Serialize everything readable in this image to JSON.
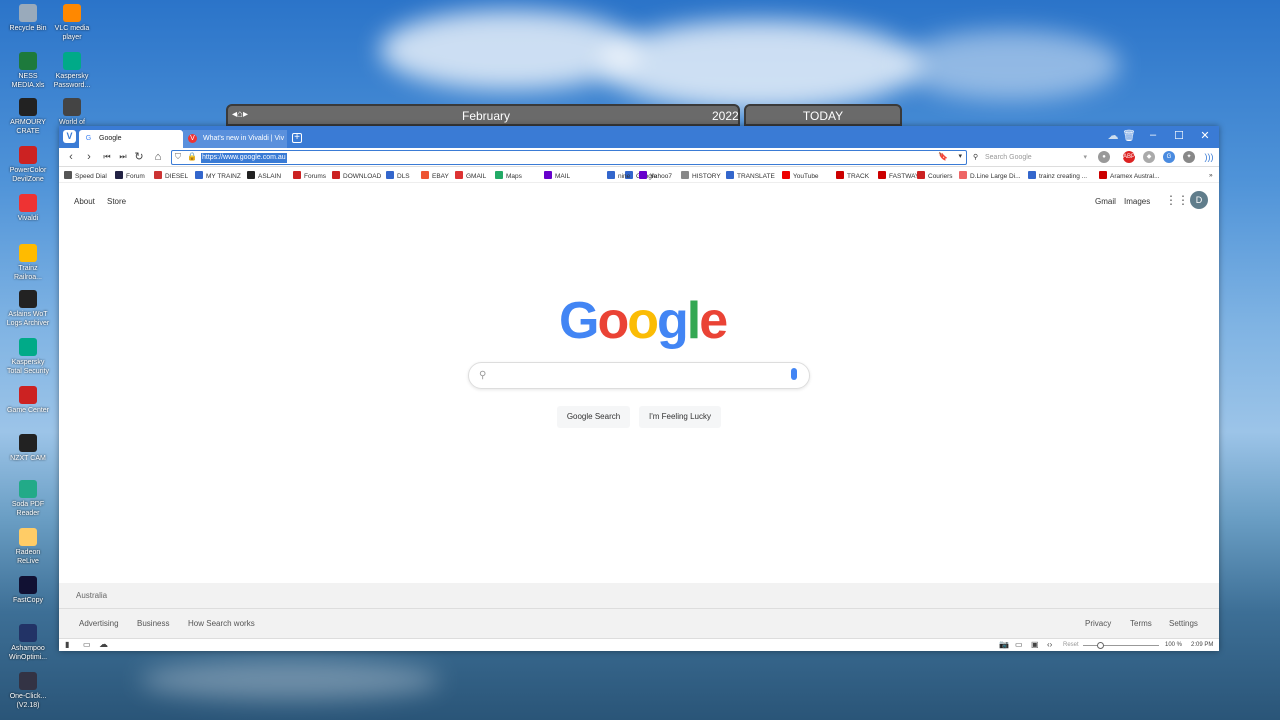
{
  "desktop": {
    "icons": [
      {
        "label": "Recycle Bin",
        "color": "#9ab"
      },
      {
        "label": "VLC media player",
        "color": "#f80"
      },
      {
        "label": "NESS MEDIA.xls",
        "color": "#1d7a3c"
      },
      {
        "label": "Kaspersky Password...",
        "color": "#0a8"
      },
      {
        "label": "ARMOURY CRATE",
        "color": "#222"
      },
      {
        "label": "World of Tan...",
        "color": "#444"
      },
      {
        "label": "PowerColor DevilZone",
        "color": "#c22"
      },
      {
        "label": "Vivaldi",
        "color": "#e33"
      },
      {
        "label": "Trainz Railroa...",
        "color": "#fb0"
      },
      {
        "label": "Aslains WoT Logs Archiver",
        "color": "#222"
      },
      {
        "label": "Kaspersky Total Security",
        "color": "#0a8"
      },
      {
        "label": "Game Center",
        "color": "#c22"
      },
      {
        "label": "NZXT CAM",
        "color": "#222"
      },
      {
        "label": "Soda PDF Reader",
        "color": "#2a8"
      },
      {
        "label": "Radeon ReLive",
        "color": "#fc6"
      },
      {
        "label": "FastCopy",
        "color": "#113"
      },
      {
        "label": "Ashampoo WinOptimi...",
        "color": "#236"
      },
      {
        "label": "One-Click... (V2.18)",
        "color": "#334"
      }
    ]
  },
  "calendar": {
    "month": "February",
    "year": "2022",
    "today": "TODAY"
  },
  "browser": {
    "tabs": [
      {
        "title": "Google",
        "favicon": "G",
        "active": true
      },
      {
        "title": "What's new in Vivaldi | Viv",
        "favicon": "V",
        "active": false
      }
    ],
    "url": "https://www.google.com.au",
    "search_placeholder": "Search Google",
    "bookmarks": [
      {
        "label": "Speed Dial",
        "color": "#555"
      },
      {
        "label": "Forum",
        "color": "#224"
      },
      {
        "label": "DIESEL",
        "color": "#c33"
      },
      {
        "label": "MY TRAINZ",
        "color": "#36c"
      },
      {
        "label": "ASLAIN",
        "color": "#222"
      },
      {
        "label": "Forums",
        "color": "#c22"
      },
      {
        "label": "DOWNLOAD",
        "color": "#c22"
      },
      {
        "label": "DLS",
        "color": "#36c"
      },
      {
        "label": "EBAY",
        "color": "#e53"
      },
      {
        "label": "GMAIL",
        "color": "#d33"
      },
      {
        "label": "Maps",
        "color": "#2a6"
      },
      {
        "label": "MAIL",
        "color": "#60c"
      },
      {
        "label": "Google",
        "color": "#36c"
      },
      {
        "label": "nine",
        "color": "#36c"
      },
      {
        "label": "Yahoo7",
        "color": "#60c"
      },
      {
        "label": "HISTORY",
        "color": "#888"
      },
      {
        "label": "TRANSLATE",
        "color": "#36c"
      },
      {
        "label": "YouTube",
        "color": "#e00"
      },
      {
        "label": "TRACK",
        "color": "#c00"
      },
      {
        "label": "FASTWAY",
        "color": "#c00"
      },
      {
        "label": "Couriers",
        "color": "#c22"
      },
      {
        "label": "D.Line Large Di...",
        "color": "#e66"
      },
      {
        "label": "trainz creating ...",
        "color": "#36c"
      },
      {
        "label": "Aramex Austral...",
        "color": "#c00"
      }
    ]
  },
  "google": {
    "nav_left": [
      "About",
      "Store"
    ],
    "nav_right": [
      "Gmail",
      "Images"
    ],
    "avatar": "D",
    "logo_letters": [
      {
        "ch": "G",
        "color": "#4285f4"
      },
      {
        "ch": "o",
        "color": "#ea4335"
      },
      {
        "ch": "o",
        "color": "#fbbc05"
      },
      {
        "ch": "g",
        "color": "#4285f4"
      },
      {
        "ch": "l",
        "color": "#34a853"
      },
      {
        "ch": "e",
        "color": "#ea4335"
      }
    ],
    "search_button": "Google Search",
    "lucky_button": "I'm Feeling Lucky",
    "footer_location": "Australia",
    "footer_left": [
      "Advertising",
      "Business",
      "How Search works"
    ],
    "footer_right": [
      "Privacy",
      "Terms",
      "Settings"
    ]
  },
  "statusbar": {
    "reset": "Reset",
    "zoom": "100 %",
    "time": "2:09 PM"
  }
}
